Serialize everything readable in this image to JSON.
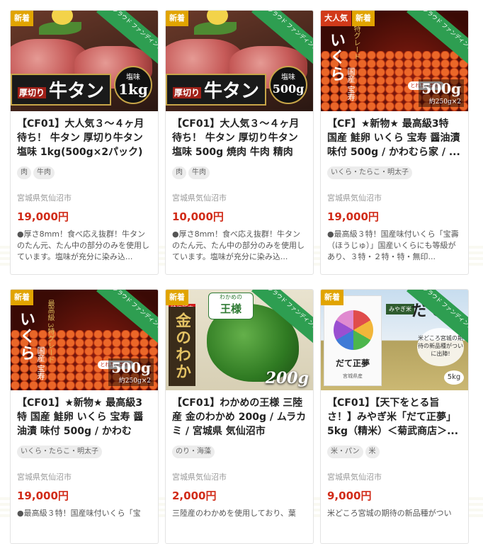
{
  "products": [
    {
      "badges": [
        {
          "text": "新着",
          "kind": "new"
        }
      ],
      "ribbon": "クラウド ファンディング",
      "art": {
        "type": "beef",
        "label_small": "厚切り",
        "label_big": "牛タン",
        "seal_top": "塩味",
        "seal_weight": "1kg"
      },
      "title": "【CF01】大人気３～４ヶ月待ち！ 牛タン 厚切り牛タン 塩味 1kg(500g×2パック) ...",
      "tags": [
        "肉",
        "牛肉"
      ],
      "location": "宮城県気仙沼市",
      "price": "19,000円",
      "description": "●厚さ8mm！食べ応え抜群！牛タンのたん元、たん中の部分のみを使用しています。塩味が充分に染み込..."
    },
    {
      "badges": [
        {
          "text": "新着",
          "kind": "new"
        }
      ],
      "ribbon": "クラウド ファンディング",
      "art": {
        "type": "beef",
        "label_small": "厚切り",
        "label_big": "牛タン",
        "seal_top": "塩味",
        "seal_weight": "500g"
      },
      "title": "【CF01】大人気３～４ヶ月待ち！ 牛タン 厚切り牛タン 塩味 500g 焼肉 牛肉 精肉 ...",
      "tags": [
        "肉",
        "牛肉"
      ],
      "location": "宮城県気仙沼市",
      "price": "10,000円",
      "description": "●厚さ8mm！食べ応え抜群！牛タンのたん元、たん中の部分のみを使用しています。塩味が充分に染み込..."
    },
    {
      "badges": [
        {
          "text": "大人気",
          "kind": "pop"
        },
        {
          "text": "新着",
          "kind": "new"
        }
      ],
      "ribbon": "クラウド ファンディング",
      "art": {
        "type": "ikura",
        "gold": "3特グレード",
        "title": "いくら",
        "sub": "国産 宝寿",
        "fresh": "とれたて新物!",
        "weight": "500g",
        "weight_sub": "約250g×2"
      },
      "title": "【CF】★新物★ 最高級3特 国産 鮭卵 いくら 宝寿 醤油漬 味付 500g / かわむら家 / ...",
      "tags": [
        "いくら・たらこ・明太子"
      ],
      "location": "宮城県気仙沼市",
      "price": "19,000円",
      "description": "●最高級３特！国産味付いくら「宝壽（ほうじゅ）」国産いくらにも等級があり、３特・２特・特・無印..."
    },
    {
      "badges": [
        {
          "text": "新着",
          "kind": "new"
        }
      ],
      "ribbon": "クラウド ファンディング",
      "art": {
        "type": "ikura",
        "gold": "最高級 3特グレード",
        "title": "いくら",
        "sub": "国産 宝寿",
        "fresh": "とれたて新物!",
        "weight": "500g",
        "weight_sub": "約250g×2"
      },
      "title": "【CF01】★新物★ 最高級3特 国産 鮭卵 いくら 宝寿 醤油漬 味付 500g / かわむら...",
      "tags": [
        "いくら・たらこ・明太子"
      ],
      "location": "宮城県気仙沼市",
      "price": "19,000円",
      "description": "●最高級３特！国産味付いくら「宝"
    },
    {
      "badges": [
        {
          "text": "新着",
          "kind": "new"
        }
      ],
      "ribbon": "クラウド ファンディング",
      "art": {
        "type": "wakame",
        "sale": "特価販売",
        "king_top": "わかめの",
        "king": "王様",
        "title": "金のわかめ",
        "weight": "200g"
      },
      "title": "【CF01】わかめの王様 三陸産 金のわかめ 200g / ムラカミ / 宮城県 気仙沼市",
      "tags": [
        "のり・海藻"
      ],
      "location": "宮城県気仙沼市",
      "price": "2,000円",
      "description": "三陸産のわかめを使用しており、葉"
    },
    {
      "badges": [
        {
          "text": "新着",
          "kind": "new"
        }
      ],
      "ribbon": "クラウド ファンディング",
      "art": {
        "type": "rice",
        "bag_name": "だて正夢",
        "bag_sub": "宮城県産",
        "right_label": "みやぎ米",
        "right_title": "だて",
        "new_text": "米どころ宮城の期待の新品種がついに出陣!",
        "kg": "5kg"
      },
      "title": "【CF01】【天下をとる旨さ！】みやぎ米「だて正夢」5kg（精米）＜菊武商店＞...",
      "tags": [
        "米・パン",
        "米"
      ],
      "location": "宮城県気仙沼市",
      "price": "9,000円",
      "description": "米どころ宮城の期待の新品種がつい"
    }
  ]
}
